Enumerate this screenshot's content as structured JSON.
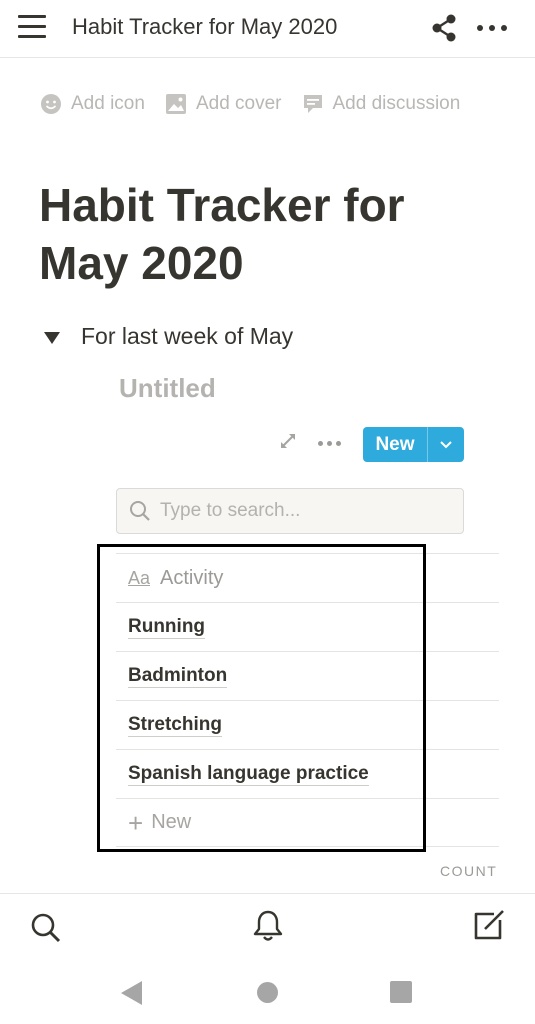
{
  "topbar": {
    "page_name": "Habit Tracker for May 2020",
    "icons": {
      "menu": "hamburger-menu-icon",
      "share": "share-icon",
      "more": "more-horizontal-icon"
    }
  },
  "meta_actions": {
    "add_icon": "Add icon",
    "add_cover": "Add cover",
    "add_discussion": "Add discussion"
  },
  "page": {
    "title_line1": "Habit Tracker for",
    "title_line2": "May 2020"
  },
  "toggle": {
    "label": "For last week of May"
  },
  "database": {
    "title": "Untitled",
    "new_button_label": "New",
    "search_placeholder": "Type to search...",
    "column_header": {
      "icon_text": "Aa",
      "label": "Activity"
    },
    "rows": [
      "Running",
      "Badminton",
      "Stretching",
      "Spanish language practice"
    ],
    "add_row_label": "New",
    "footer_label": "COUNT"
  },
  "bottom_nav": {
    "icons": [
      "search-icon",
      "bell-icon",
      "compose-icon"
    ]
  },
  "android_nav": [
    "back",
    "home",
    "recents"
  ],
  "colors": {
    "accent": "#2eaadc",
    "text": "#37352f",
    "muted": "#9b9a97",
    "highlight_border": "#000000"
  }
}
